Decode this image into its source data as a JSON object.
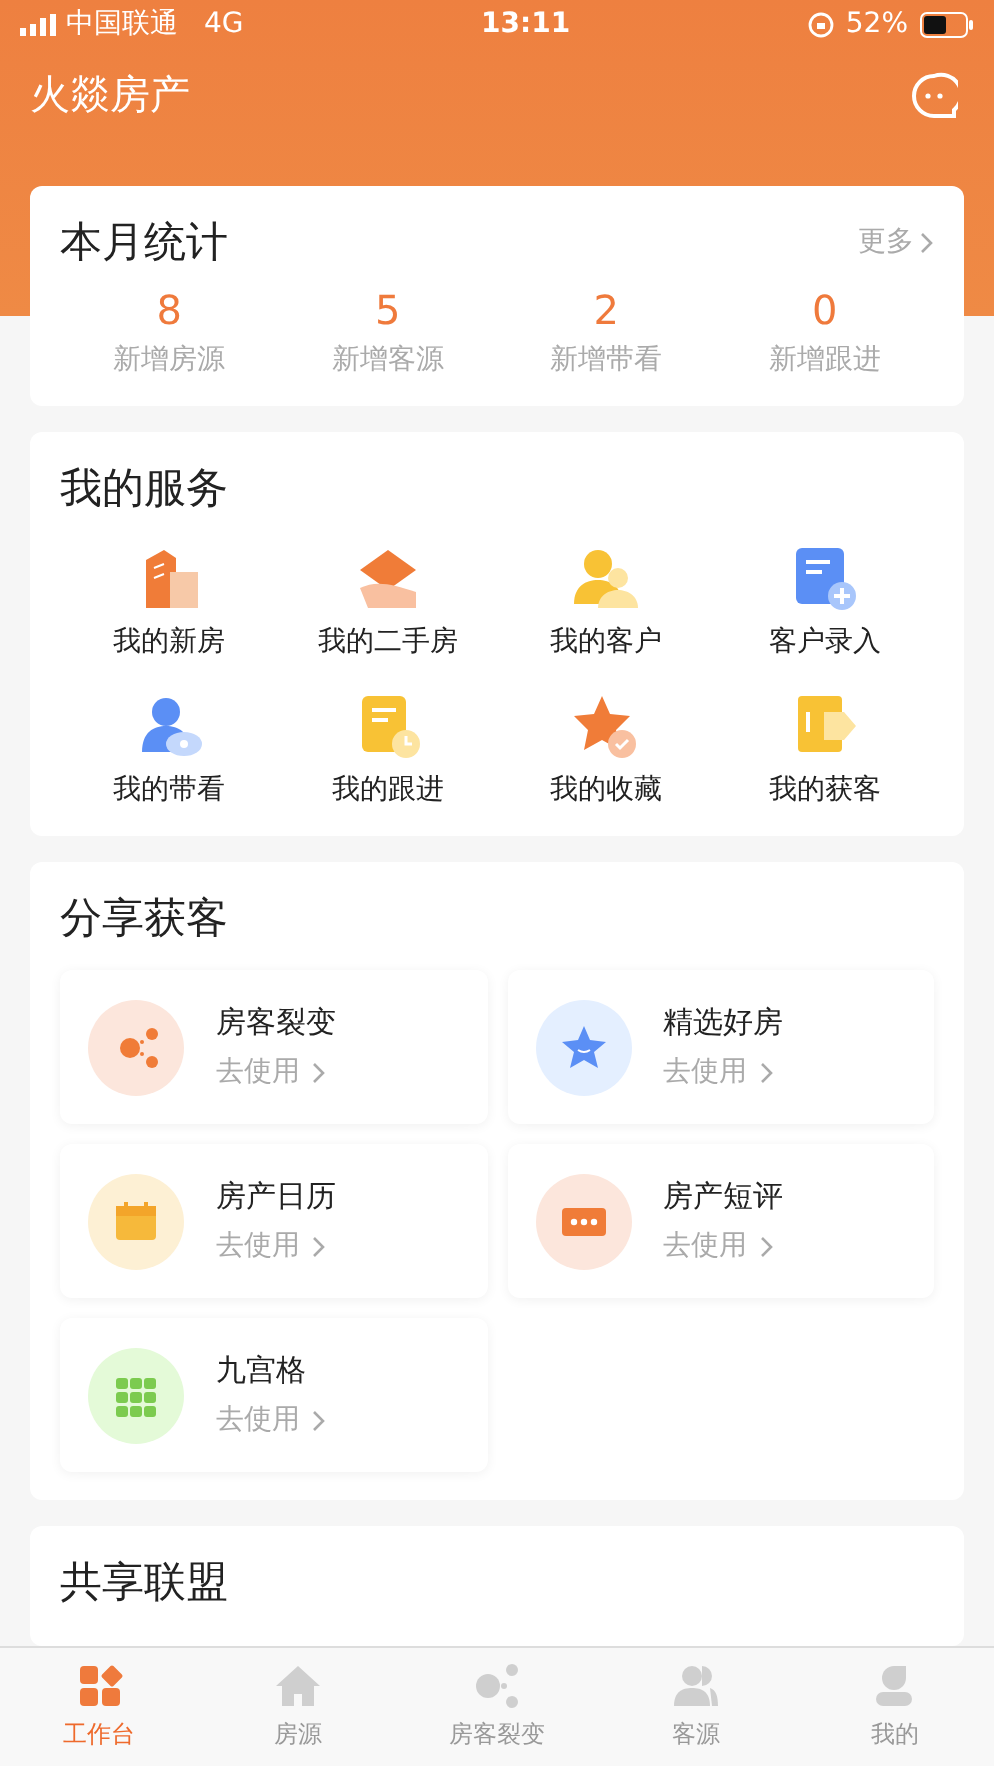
{
  "status_bar": {
    "carrier": "中国联通",
    "network": "4G",
    "time": "13:11",
    "battery": "52%"
  },
  "header": {
    "title": "火燚房产"
  },
  "stats": {
    "title": "本月统计",
    "more": "更多",
    "items": [
      {
        "value": "8",
        "label": "新增房源"
      },
      {
        "value": "5",
        "label": "新增客源"
      },
      {
        "value": "2",
        "label": "新增带看"
      },
      {
        "value": "0",
        "label": "新增跟进"
      }
    ]
  },
  "services": {
    "title": "我的服务",
    "items": [
      {
        "label": "我的新房"
      },
      {
        "label": "我的二手房"
      },
      {
        "label": "我的客户"
      },
      {
        "label": "客户录入"
      },
      {
        "label": "我的带看"
      },
      {
        "label": "我的跟进"
      },
      {
        "label": "我的收藏"
      },
      {
        "label": "我的获客"
      }
    ]
  },
  "share": {
    "title": "分享获客",
    "items": [
      {
        "title": "房客裂变",
        "action": "去使用"
      },
      {
        "title": "精选好房",
        "action": "去使用"
      },
      {
        "title": "房产日历",
        "action": "去使用"
      },
      {
        "title": "房产短评",
        "action": "去使用"
      },
      {
        "title": "九宫格",
        "action": "去使用"
      }
    ]
  },
  "alliance": {
    "title": "共享联盟"
  },
  "tabs": [
    {
      "label": "工作台",
      "selected": true
    },
    {
      "label": "房源",
      "selected": false
    },
    {
      "label": "房客裂变",
      "selected": false
    },
    {
      "label": "客源",
      "selected": false
    },
    {
      "label": "我的",
      "selected": false
    }
  ]
}
